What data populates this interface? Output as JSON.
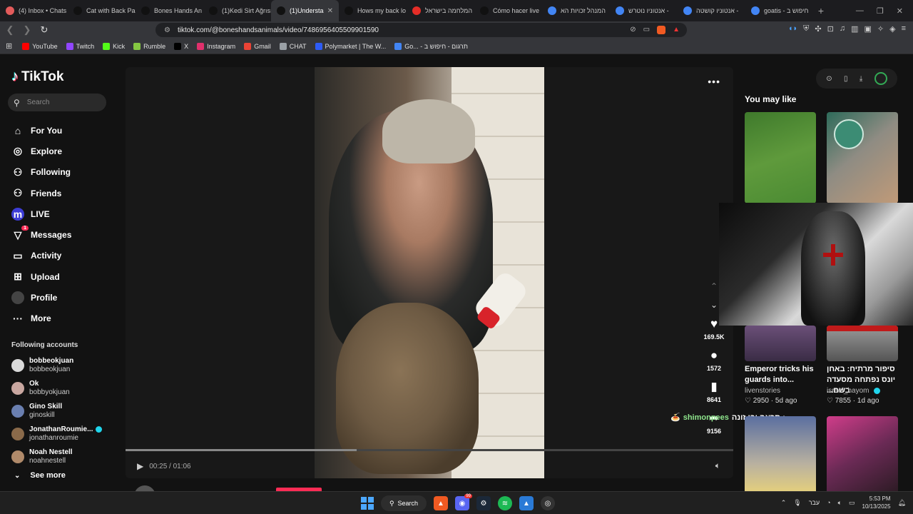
{
  "tabs": [
    {
      "label": "(4) Inbox • Chats",
      "fav": "#e35b5b",
      "active": false
    },
    {
      "label": "Cat with Back Pa",
      "fav": "#111111",
      "active": false
    },
    {
      "label": "Bones Hands An",
      "fav": "#111111",
      "active": false
    },
    {
      "label": "(1)Kedi Sirt Ağrısı",
      "fav": "#111111",
      "active": false
    },
    {
      "label": "(1)Understa",
      "fav": "#111111",
      "active": true
    },
    {
      "label": "Hows my back lo",
      "fav": "#111111",
      "active": false
    },
    {
      "label": "המלחמה בישראל",
      "fav": "#e52d27",
      "active": false
    },
    {
      "label": "Cómo hacer live",
      "fav": "#111111",
      "active": false
    },
    {
      "label": "המנהל זכויות הא",
      "fav": "#4285f4",
      "active": false
    },
    {
      "label": "אנטוניו נוטרש -",
      "fav": "#4285f4",
      "active": false
    },
    {
      "label": "אנטוניו קושטה -",
      "fav": "#4285f4",
      "active": false
    },
    {
      "label": "goatis - חיפוש ב",
      "fav": "#4285f4",
      "active": false
    }
  ],
  "browser": {
    "url": "tiktok.com/@boneshandsanimals/video/7486956405509901590",
    "new_tab": "+"
  },
  "bookmarks": [
    {
      "label": "YouTube",
      "color": "#ff0000"
    },
    {
      "label": "Twitch",
      "color": "#9146ff"
    },
    {
      "label": "Kick",
      "color": "#53fc18"
    },
    {
      "label": "Rumble",
      "color": "#85c742"
    },
    {
      "label": "X",
      "color": "#000000"
    },
    {
      "label": "Instagram",
      "color": "#e1306c"
    },
    {
      "label": "Gmail",
      "color": "#ea4335"
    },
    {
      "label": "CHAT",
      "color": "#9aa0a6"
    },
    {
      "label": "Polymarket | The W...",
      "color": "#2d5cf6"
    },
    {
      "label": "Go... - תרגום - חיפוש ב",
      "color": "#4285f4"
    }
  ],
  "sidebar": {
    "logo": "TikTok",
    "search_placeholder": "Search",
    "menu": [
      {
        "label": "For You",
        "icon": "home-icon"
      },
      {
        "label": "Explore",
        "icon": "compass-icon"
      },
      {
        "label": "Following",
        "icon": "following-icon"
      },
      {
        "label": "Friends",
        "icon": "friends-icon"
      },
      {
        "label": "LIVE",
        "icon": "live-icon"
      },
      {
        "label": "Messages",
        "icon": "messages-icon",
        "badge": "1"
      },
      {
        "label": "Activity",
        "icon": "activity-icon"
      },
      {
        "label": "Upload",
        "icon": "upload-icon"
      },
      {
        "label": "Profile",
        "icon": "profile-icon"
      },
      {
        "label": "More",
        "icon": "more-icon"
      }
    ],
    "following_heading": "Following accounts",
    "following": [
      {
        "name": "bobbeokjuan",
        "handle": "bobbeokjuan",
        "verified": false
      },
      {
        "name": "Ok",
        "handle": "bobbyokjuan",
        "verified": false
      },
      {
        "name": "Gino Skill",
        "handle": "ginoskill",
        "verified": false
      },
      {
        "name": "JonathanRoumie...",
        "handle": "jonathanroumie",
        "verified": true
      },
      {
        "name": "Noah Nestell",
        "handle": "noahnestell",
        "verified": false
      }
    ],
    "see_more": "See more"
  },
  "player": {
    "time": "00:25 / 01:06",
    "progress": 0.38,
    "author": "boneshandsanimals",
    "more": "•••"
  },
  "actions": {
    "likes": "169.5K",
    "comments": "1572",
    "saves": "8641",
    "shares": "9156"
  },
  "chat_overlay": {
    "emoji": "🍝",
    "user": "shimonpees",
    "message": "תראה יבן זונה :"
  },
  "right_panel": {
    "heading": "You may like",
    "cards": [
      {
        "title": "Emperor tricks his guards into...",
        "user": "livenstories",
        "likes": "2950",
        "age": "5d ago",
        "verified": false
      },
      {
        "title": "סיפור מרתיח: באחן יונס נפתחה מסעדה בשם...",
        "user": "israel_hayom",
        "likes": "7855",
        "age": "1d ago",
        "verified": true
      }
    ]
  },
  "taskbar": {
    "search_label": "Search",
    "discord_badge": "99",
    "lang": "עבר",
    "time": "5:53 PM",
    "date": "10/13/2025"
  }
}
